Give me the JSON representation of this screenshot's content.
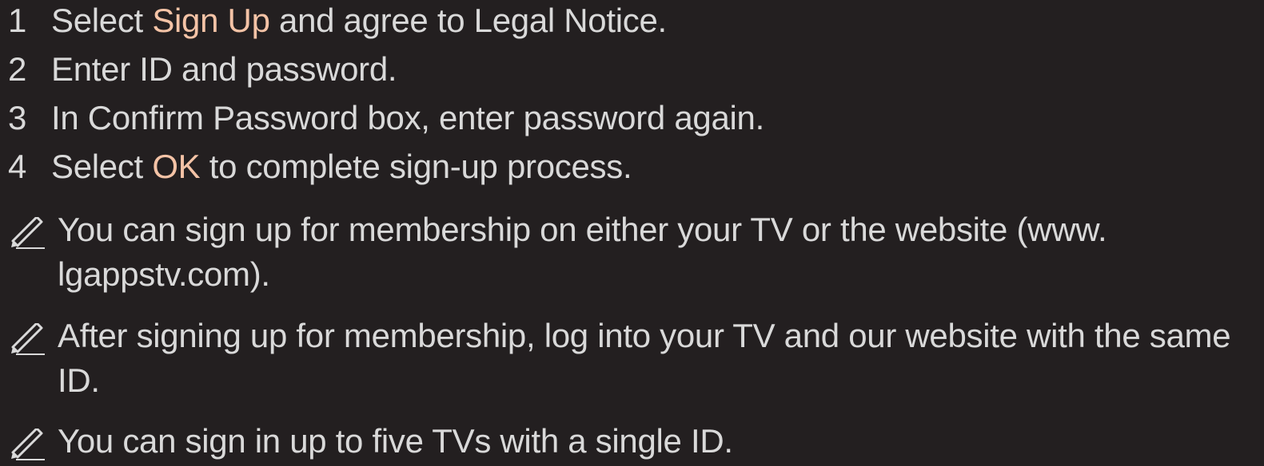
{
  "steps": [
    {
      "num": "1",
      "pre": "Select ",
      "highlight": "Sign Up",
      "post": " and agree to Legal Notice."
    },
    {
      "num": "2",
      "text": "Enter ID and password."
    },
    {
      "num": "3",
      "text": "In Confirm Password box, enter password again."
    },
    {
      "num": "4",
      "pre": "Select ",
      "highlight": "OK",
      "post": " to complete sign-up process."
    }
  ],
  "notes": [
    {
      "icon": "pencil-note-icon",
      "text": "You can sign up for membership on either your TV or the website (www.​lgappstv.com)."
    },
    {
      "icon": "pencil-note-icon",
      "text": "After signing up for membership, log into your TV and our website with the same ID."
    },
    {
      "icon": "pencil-note-icon",
      "text": "You can sign in up to five TVs with a single ID."
    }
  ],
  "colors": {
    "background": "#231f20",
    "text": "#d9d9d9",
    "highlight": "#f4c3a6"
  }
}
